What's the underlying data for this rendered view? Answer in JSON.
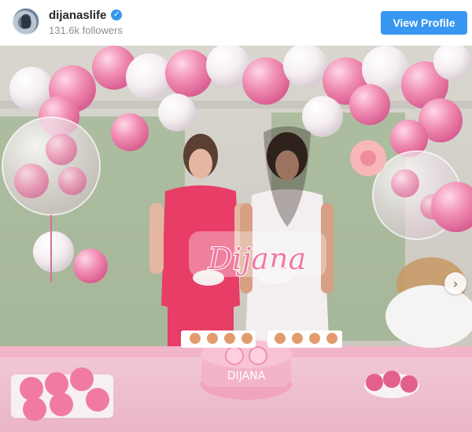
{
  "profile": {
    "username": "dijanaslife",
    "followers_text": "131.6k followers",
    "verified_icon": "verified-badge-icon",
    "view_profile_label": "View Profile"
  },
  "photo": {
    "name_sign": "Dijana",
    "cake_text": "DIJANA",
    "next_icon": "chevron-right-icon"
  }
}
